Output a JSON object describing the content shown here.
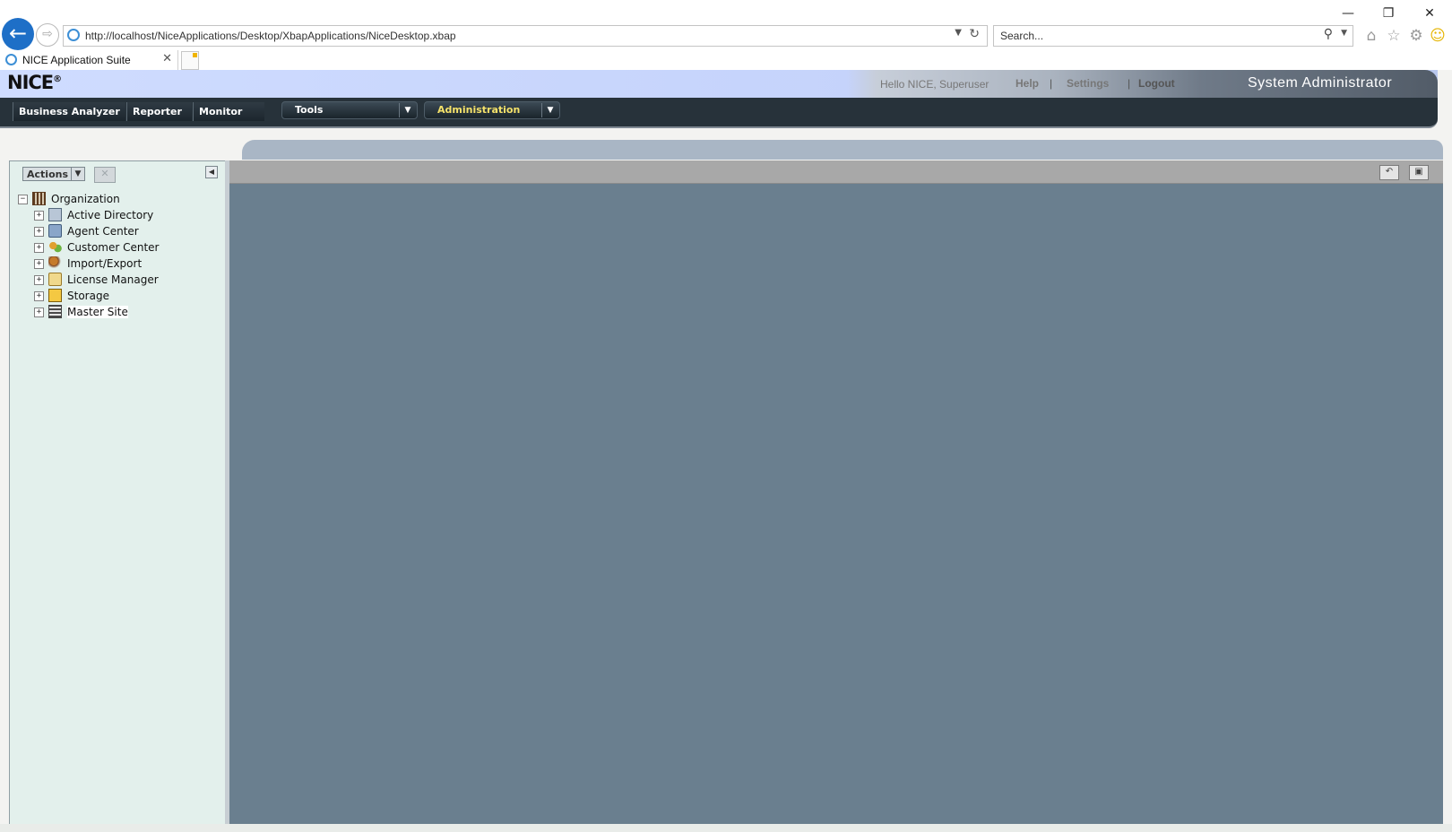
{
  "browser": {
    "address_url": "http://localhost/NiceApplications/Desktop/XbapApplications/NiceDesktop.xbap",
    "search_placeholder": "Search...",
    "tab_title": "NICE Application Suite",
    "icons": [
      "back-arrow-icon",
      "forward-arrow-icon",
      "ie-icon",
      "dropdown-arrow-icon",
      "refresh-icon",
      "search-icon",
      "home-icon",
      "star-icon",
      "gear-icon",
      "smiley-icon",
      "minimize-icon",
      "restore-icon",
      "close-icon"
    ]
  },
  "app": {
    "logo": "NICE",
    "logo_mark": "®",
    "greeting": "Hello NICE, Superuser",
    "help_link": "Help",
    "settings_link": "Settings",
    "logout_link": "Logout",
    "separator": "|",
    "role": "System Administrator"
  },
  "nav": {
    "tabs": [
      {
        "label": "Business Analyzer"
      },
      {
        "label": "Reporter"
      },
      {
        "label": "Monitor"
      }
    ],
    "tools_label": "Tools",
    "admin_label": "Administration",
    "admin_color": "#f5e26a"
  },
  "left_panel": {
    "actions_label": "Actions",
    "tree": {
      "root": "Organization",
      "children": [
        {
          "label": "Active Directory",
          "icon": "active-directory-icon"
        },
        {
          "label": "Agent Center",
          "icon": "agent-center-icon"
        },
        {
          "label": "Customer Center",
          "icon": "customer-center-icon"
        },
        {
          "label": "Import/Export",
          "icon": "import-export-icon"
        },
        {
          "label": "License Manager",
          "icon": "license-manager-icon"
        },
        {
          "label": "Storage",
          "icon": "storage-icon"
        },
        {
          "label": "Master Site",
          "icon": "master-site-icon"
        }
      ]
    }
  },
  "colors": {
    "header_band": "#c5d3fb",
    "navbar": "#27323a",
    "tree_panel": "#e3f0ec",
    "content_area": "#6a7f8f",
    "back_button": "#1e6fc7"
  }
}
